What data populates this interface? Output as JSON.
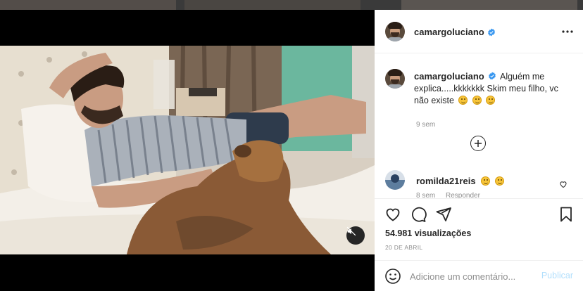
{
  "post": {
    "author": "camargoluciano",
    "caption_text": "Alguém me explica.....kkkkkkk Skim meu filho, vc não existe",
    "caption_time": "9 sem",
    "views": "54.981 visualizações",
    "date": "20 DE ABRIL"
  },
  "comments": [
    {
      "username": "romilda21reis",
      "time": "8 sem",
      "reply_label": "Responder"
    }
  ],
  "composer": {
    "placeholder": "Adicione um comentário...",
    "publish_label": "Publicar"
  },
  "icons": {
    "verified": "verified-badge-icon",
    "more": "more-options-icon",
    "load_more": "plus-circle-icon",
    "like": "heart-icon",
    "comment": "comment-bubble-icon",
    "share": "paper-plane-icon",
    "save": "bookmark-icon",
    "emoji": "smiley-icon",
    "mute": "muted-speaker-icon"
  },
  "colors": {
    "verified_blue": "#3897f0",
    "publish_disabled": "#b2dffc",
    "secondary_text": "#8e8e8e",
    "primary_text": "#262626"
  }
}
